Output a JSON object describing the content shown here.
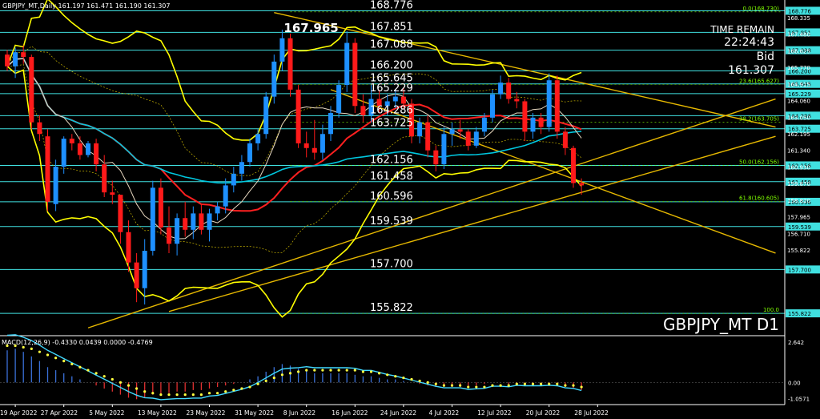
{
  "header": {
    "symbol_line": "GBPJPY_MT,Daily  161.197 161.471 161.190 161.307",
    "macd_line": "MACD(12,26,9) -0.4330 0.0439 0.0000 -0.4769"
  },
  "info": {
    "time_remain_label": "TIME REMAIN",
    "time_remain": "22:24:43",
    "bid_label": "Bid",
    "bid": "161.307",
    "watermark": "GBPJPY_MT D1"
  },
  "colors": {
    "bull": "#1e90ff",
    "bear": "#ff1a1a",
    "level_line": "#40e0e0",
    "trend_line": "#e6b800",
    "bollinger": "#ffff00",
    "ma_red": "#ff2020",
    "ma_cyan": "#00c8e0",
    "macd_line": "#40d8ff",
    "macd_signal": "#ffff40",
    "axis": "#ffffff"
  },
  "chart_data": {
    "type": "candlestick",
    "y_range": [
      154.9,
      169.1
    ],
    "macd_range": [
      -1.45,
      2.9
    ],
    "price_axis_ticks": [
      "168.335",
      "167.480",
      "166.625",
      "165.770",
      "164.915",
      "164.060",
      "163.050",
      "162.195",
      "161.340",
      "160.930",
      "159.870",
      "158.820",
      "157.965",
      "156.710",
      "155.822"
    ],
    "date_labels": [
      {
        "label": "19 Apr 2022",
        "bar": 1
      },
      {
        "label": "27 Apr 2022",
        "bar": 7
      },
      {
        "label": "5 May 2022",
        "bar": 13
      },
      {
        "label": "13 May 2022",
        "bar": 19
      },
      {
        "label": "23 May 2022",
        "bar": 25
      },
      {
        "label": "31 May 2022",
        "bar": 31
      },
      {
        "label": "8 Jun 2022",
        "bar": 37
      },
      {
        "label": "16 Jun 2022",
        "bar": 43
      },
      {
        "label": "24 Jun 2022",
        "bar": 49
      },
      {
        "label": "4 Jul 2022",
        "bar": 55
      },
      {
        "label": "12 Jul 2022",
        "bar": 61
      },
      {
        "label": "20 Jul 2022",
        "bar": 67
      },
      {
        "label": "28 Jul 2022",
        "bar": 73
      }
    ],
    "candles": [
      {
        "o": 166.9,
        "h": 167.1,
        "l": 166.2,
        "c": 166.4
      },
      {
        "o": 166.4,
        "h": 167.2,
        "l": 165.9,
        "c": 167.0
      },
      {
        "o": 167.0,
        "h": 167.3,
        "l": 166.5,
        "c": 166.8
      },
      {
        "o": 166.8,
        "h": 166.9,
        "l": 163.7,
        "c": 164.0
      },
      {
        "o": 164.0,
        "h": 164.3,
        "l": 163.2,
        "c": 163.5
      },
      {
        "o": 163.4,
        "h": 163.7,
        "l": 160.2,
        "c": 160.6
      },
      {
        "o": 160.5,
        "h": 162.4,
        "l": 160.2,
        "c": 162.1
      },
      {
        "o": 162.1,
        "h": 163.4,
        "l": 161.8,
        "c": 163.3
      },
      {
        "o": 163.3,
        "h": 163.5,
        "l": 162.8,
        "c": 163.1
      },
      {
        "o": 163.1,
        "h": 163.4,
        "l": 162.4,
        "c": 162.6
      },
      {
        "o": 162.6,
        "h": 163.2,
        "l": 162.5,
        "c": 163.1
      },
      {
        "o": 163.1,
        "h": 163.3,
        "l": 161.9,
        "c": 162.2
      },
      {
        "o": 162.2,
        "h": 162.6,
        "l": 160.8,
        "c": 161.0
      },
      {
        "o": 161.0,
        "h": 161.5,
        "l": 160.5,
        "c": 160.9
      },
      {
        "o": 160.9,
        "h": 160.9,
        "l": 158.8,
        "c": 159.3
      },
      {
        "o": 159.3,
        "h": 159.8,
        "l": 157.6,
        "c": 158.0
      },
      {
        "o": 158.0,
        "h": 158.4,
        "l": 156.3,
        "c": 156.9
      },
      {
        "o": 156.9,
        "h": 159.0,
        "l": 156.2,
        "c": 158.5
      },
      {
        "o": 158.5,
        "h": 161.5,
        "l": 158.3,
        "c": 161.2
      },
      {
        "o": 161.2,
        "h": 161.6,
        "l": 159.2,
        "c": 159.5
      },
      {
        "o": 159.5,
        "h": 160.4,
        "l": 158.4,
        "c": 158.8
      },
      {
        "o": 158.8,
        "h": 160.1,
        "l": 158.3,
        "c": 159.9
      },
      {
        "o": 159.9,
        "h": 160.6,
        "l": 159.1,
        "c": 159.4
      },
      {
        "o": 159.4,
        "h": 160.4,
        "l": 159.0,
        "c": 160.1
      },
      {
        "o": 160.1,
        "h": 160.5,
        "l": 159.2,
        "c": 159.4
      },
      {
        "o": 159.4,
        "h": 160.3,
        "l": 158.9,
        "c": 160.1
      },
      {
        "o": 160.1,
        "h": 160.6,
        "l": 159.8,
        "c": 160.4
      },
      {
        "o": 160.4,
        "h": 161.6,
        "l": 160.1,
        "c": 161.3
      },
      {
        "o": 161.3,
        "h": 162.1,
        "l": 161.0,
        "c": 161.8
      },
      {
        "o": 161.8,
        "h": 162.6,
        "l": 161.5,
        "c": 162.3
      },
      {
        "o": 162.3,
        "h": 163.3,
        "l": 162.1,
        "c": 163.1
      },
      {
        "o": 163.1,
        "h": 163.7,
        "l": 162.8,
        "c": 163.5
      },
      {
        "o": 163.5,
        "h": 165.3,
        "l": 163.3,
        "c": 165.1
      },
      {
        "o": 165.1,
        "h": 166.9,
        "l": 164.8,
        "c": 166.6
      },
      {
        "o": 166.6,
        "h": 167.965,
        "l": 166.2,
        "c": 167.6
      },
      {
        "o": 167.6,
        "h": 167.8,
        "l": 165.1,
        "c": 165.4
      },
      {
        "o": 165.4,
        "h": 165.6,
        "l": 162.9,
        "c": 163.1
      },
      {
        "o": 163.1,
        "h": 163.6,
        "l": 162.5,
        "c": 162.9
      },
      {
        "o": 162.9,
        "h": 164.1,
        "l": 162.4,
        "c": 162.7
      },
      {
        "o": 162.7,
        "h": 163.9,
        "l": 162.4,
        "c": 163.5
      },
      {
        "o": 163.5,
        "h": 164.7,
        "l": 163.2,
        "c": 164.4
      },
      {
        "o": 164.4,
        "h": 165.8,
        "l": 164.2,
        "c": 165.6
      },
      {
        "o": 165.6,
        "h": 167.9,
        "l": 165.3,
        "c": 167.4
      },
      {
        "o": 167.4,
        "h": 167.6,
        "l": 164.4,
        "c": 164.7
      },
      {
        "o": 164.7,
        "h": 165.2,
        "l": 164.0,
        "c": 164.3
      },
      {
        "o": 164.3,
        "h": 165.6,
        "l": 164.0,
        "c": 165.0
      },
      {
        "o": 165.0,
        "h": 165.4,
        "l": 164.4,
        "c": 164.7
      },
      {
        "o": 164.7,
        "h": 165.2,
        "l": 164.3,
        "c": 164.9
      },
      {
        "o": 164.9,
        "h": 165.4,
        "l": 164.6,
        "c": 165.1
      },
      {
        "o": 165.1,
        "h": 165.5,
        "l": 164.6,
        "c": 164.8
      },
      {
        "o": 164.8,
        "h": 165.0,
        "l": 163.1,
        "c": 163.4
      },
      {
        "o": 163.4,
        "h": 164.2,
        "l": 163.1,
        "c": 164.0
      },
      {
        "o": 164.0,
        "h": 164.3,
        "l": 162.5,
        "c": 162.8
      },
      {
        "o": 162.8,
        "h": 163.0,
        "l": 161.9,
        "c": 162.2
      },
      {
        "o": 162.2,
        "h": 163.8,
        "l": 162.0,
        "c": 163.5
      },
      {
        "o": 163.5,
        "h": 164.0,
        "l": 163.0,
        "c": 163.7
      },
      {
        "o": 163.7,
        "h": 164.1,
        "l": 163.3,
        "c": 163.6
      },
      {
        "o": 163.6,
        "h": 163.7,
        "l": 162.8,
        "c": 163.0
      },
      {
        "o": 163.0,
        "h": 163.8,
        "l": 162.9,
        "c": 163.6
      },
      {
        "o": 163.6,
        "h": 164.4,
        "l": 163.4,
        "c": 164.2
      },
      {
        "o": 164.2,
        "h": 165.4,
        "l": 164.0,
        "c": 165.2
      },
      {
        "o": 165.2,
        "h": 166.0,
        "l": 165.0,
        "c": 165.7
      },
      {
        "o": 165.7,
        "h": 165.9,
        "l": 164.8,
        "c": 165.0
      },
      {
        "o": 165.0,
        "h": 165.3,
        "l": 164.6,
        "c": 164.9
      },
      {
        "o": 164.9,
        "h": 165.0,
        "l": 163.2,
        "c": 163.6
      },
      {
        "o": 163.6,
        "h": 164.4,
        "l": 163.3,
        "c": 164.2
      },
      {
        "o": 164.2,
        "h": 164.4,
        "l": 163.5,
        "c": 163.8
      },
      {
        "o": 163.8,
        "h": 166.1,
        "l": 163.6,
        "c": 165.8
      },
      {
        "o": 165.8,
        "h": 166.0,
        "l": 163.3,
        "c": 163.6
      },
      {
        "o": 163.6,
        "h": 163.8,
        "l": 162.6,
        "c": 162.9
      },
      {
        "o": 162.9,
        "h": 163.0,
        "l": 161.2,
        "c": 161.4
      },
      {
        "o": 161.4,
        "h": 161.6,
        "l": 160.9,
        "c": 161.3
      }
    ],
    "horizontal_levels": [
      {
        "price": 168.776,
        "label": "168.776"
      },
      {
        "price": 167.851,
        "label": "167.851"
      },
      {
        "price": 167.088,
        "label": "167.088"
      },
      {
        "price": 166.2,
        "label": "166.200"
      },
      {
        "price": 165.645,
        "label": "165.645"
      },
      {
        "price": 165.229,
        "label": "165.229"
      },
      {
        "price": 164.286,
        "label": "164.286"
      },
      {
        "price": 163.725,
        "label": "163.725"
      },
      {
        "price": 162.156,
        "label": "162.156"
      },
      {
        "price": 161.458,
        "label": "161.458"
      },
      {
        "price": 160.596,
        "label": "160.596"
      },
      {
        "price": 159.539,
        "label": "159.539"
      },
      {
        "price": 157.7,
        "label": "157.700"
      },
      {
        "price": 155.822,
        "label": "155.822"
      }
    ],
    "fib_levels": [
      {
        "price": 168.73,
        "label": "0.0(168.730)"
      },
      {
        "price": 165.627,
        "label": "23.6(165.627)"
      },
      {
        "price": 164.005,
        "label": "38.2(163.705)"
      },
      {
        "price": 162.156,
        "label": "50.0(162.156)"
      },
      {
        "price": 160.605,
        "label": "61.8(160.605)"
      },
      {
        "price": 155.822,
        "label": "100.0"
      }
    ],
    "peak_annotation": {
      "label": "167.965",
      "price": 167.965,
      "bar": 34
    },
    "trendlines": [
      {
        "b1": 33,
        "p1": 168.7,
        "b2": 95,
        "p2": 163.8
      },
      {
        "b1": 40,
        "p1": 165.4,
        "b2": 95,
        "p2": 158.4
      },
      {
        "b1": 10,
        "p1": 155.2,
        "b2": 95,
        "p2": 165.0
      },
      {
        "b1": 20,
        "p1": 155.9,
        "b2": 95,
        "p2": 163.4
      }
    ],
    "macd_axis_labels": [
      "2.642",
      "0.00",
      "-1.0571"
    ],
    "macd_histogram": [
      2.1,
      2.2,
      2.0,
      1.7,
      1.4,
      1.0,
      0.8,
      0.6,
      0.4,
      0.2,
      0.0,
      -0.2,
      -0.4,
      -0.6,
      -0.8,
      -1.0,
      -1.1,
      -1.0,
      -0.8,
      -0.8,
      -0.7,
      -0.6,
      -0.6,
      -0.5,
      -0.5,
      -0.4,
      -0.3,
      -0.2,
      -0.1,
      0.0,
      0.2,
      0.4,
      0.7,
      1.0,
      1.2,
      1.1,
      0.9,
      0.8,
      0.6,
      0.6,
      0.6,
      0.6,
      0.6,
      0.5,
      0.4,
      0.4,
      0.3,
      0.2,
      0.2,
      0.1,
      0.0,
      -0.1,
      -0.2,
      -0.3,
      -0.3,
      -0.3,
      -0.3,
      -0.3,
      -0.2,
      -0.1,
      0.0,
      0.0,
      -0.1,
      -0.1,
      -0.2,
      -0.2,
      -0.2,
      -0.1,
      -0.2,
      -0.3,
      -0.4,
      -0.5
    ],
    "macd_signal": [
      2.4,
      2.4,
      2.3,
      2.2,
      2.0,
      1.8,
      1.6,
      1.4,
      1.2,
      1.0,
      0.8,
      0.6,
      0.4,
      0.2,
      0.0,
      -0.2,
      -0.4,
      -0.6,
      -0.7,
      -0.8,
      -0.8,
      -0.8,
      -0.8,
      -0.8,
      -0.8,
      -0.7,
      -0.7,
      -0.6,
      -0.5,
      -0.4,
      -0.3,
      -0.1,
      0.1,
      0.3,
      0.5,
      0.6,
      0.7,
      0.8,
      0.8,
      0.8,
      0.8,
      0.8,
      0.8,
      0.8,
      0.7,
      0.7,
      0.6,
      0.5,
      0.4,
      0.3,
      0.2,
      0.1,
      0.0,
      -0.1,
      -0.2,
      -0.2,
      -0.2,
      -0.3,
      -0.3,
      -0.3,
      -0.2,
      -0.2,
      -0.2,
      -0.1,
      -0.1,
      -0.1,
      -0.1,
      -0.1,
      -0.1,
      -0.2,
      -0.2,
      -0.3
    ]
  }
}
